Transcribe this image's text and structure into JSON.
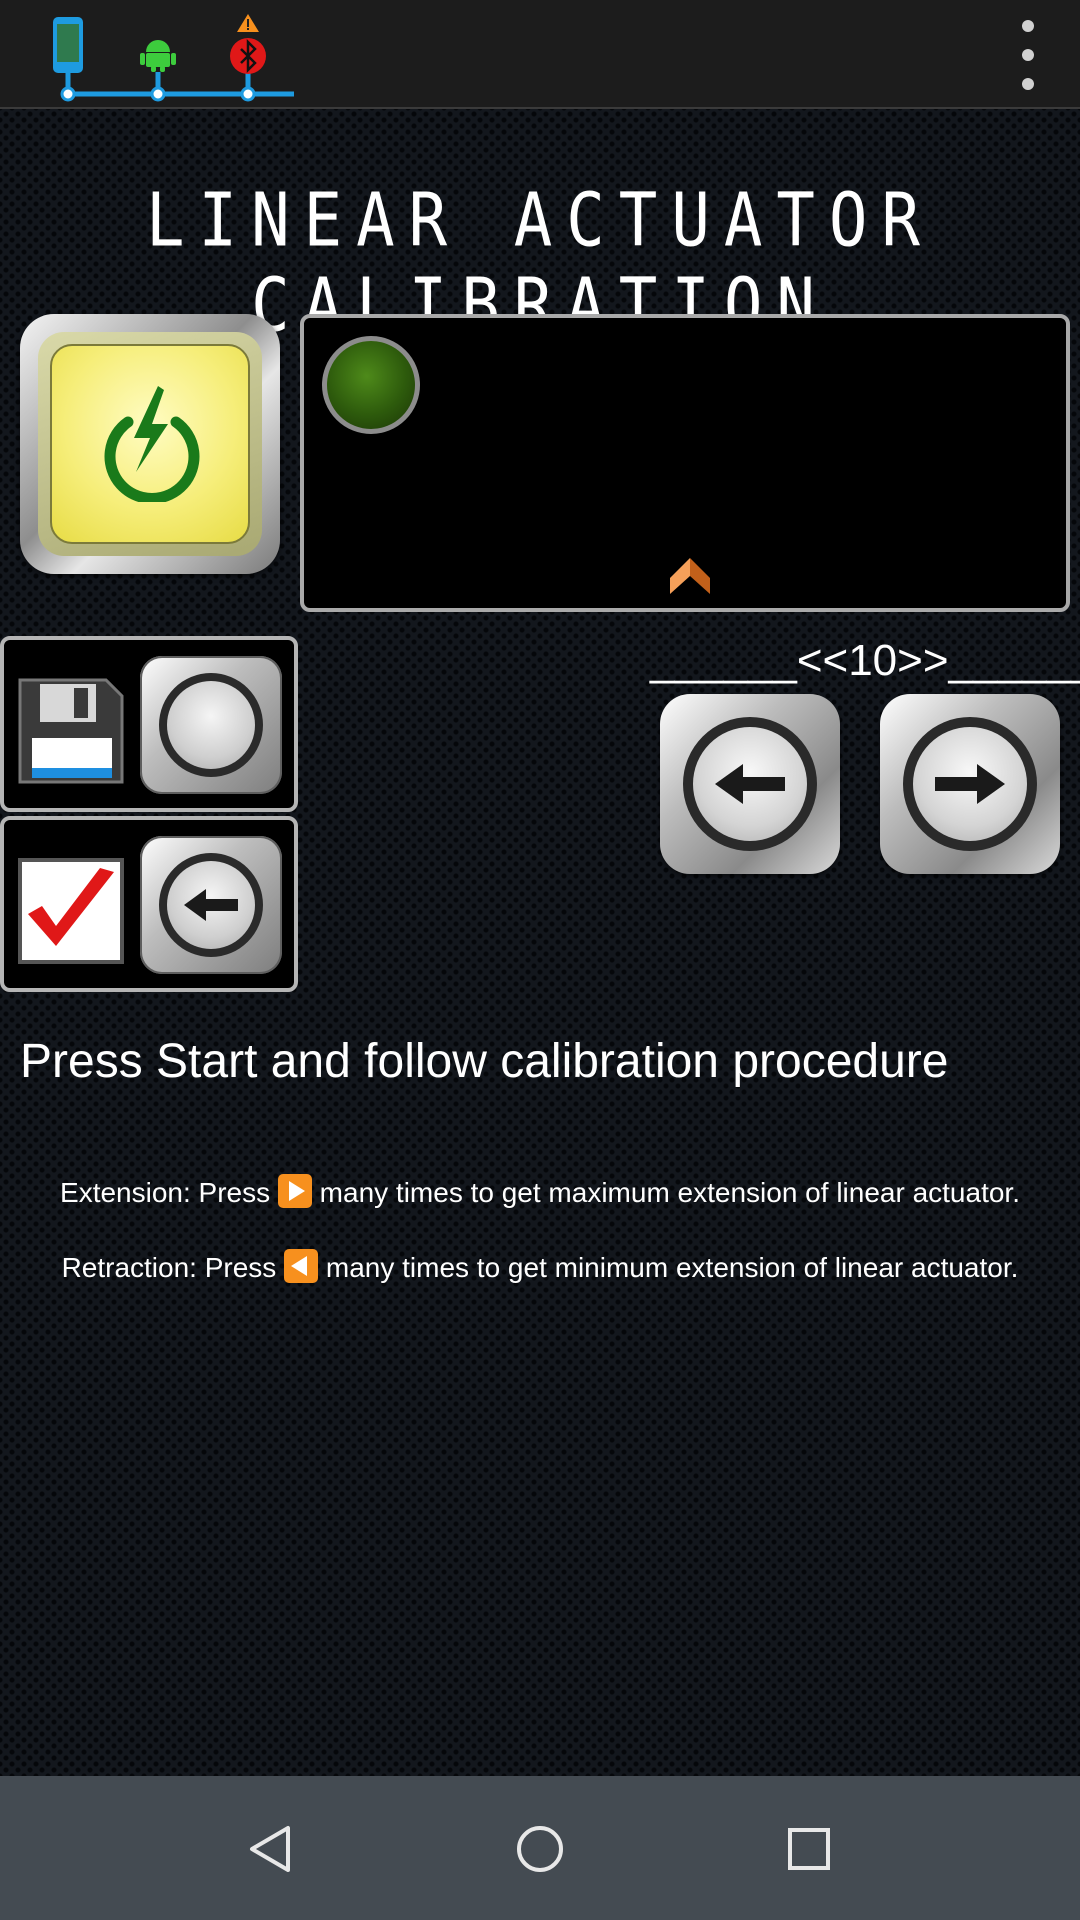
{
  "app": {
    "title": "LINEAR ACTUATOR CALIBRATION",
    "status_icons": [
      "phone-icon",
      "android-icon",
      "bluetooth-warning-icon"
    ]
  },
  "controls": {
    "step_label": "______<<10>>______"
  },
  "instructions": {
    "heading": "Press Start and follow calibration procedure",
    "extension_before": "Extension: Press ",
    "extension_after": " many times to get maximum extension of linear actuator.",
    "retraction_before": "Retraction: Press ",
    "retraction_after": " many times to get minimum extension of linear actuator."
  },
  "colors": {
    "accent_blue": "#1e9be0",
    "power_yellow": "#f6ee7a",
    "power_icon_green": "#1a7a1a",
    "led_green": "#2d5a0c",
    "marker_orange": "#f07f2a"
  }
}
